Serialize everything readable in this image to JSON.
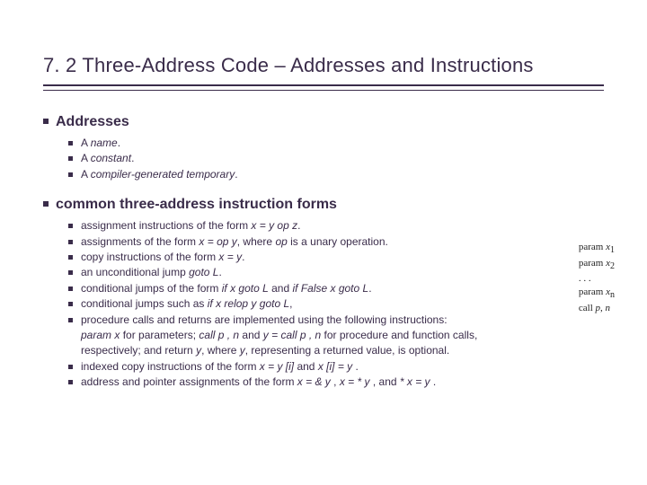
{
  "title": "7. 2 Three-Address Code – Addresses and Instructions",
  "section1": {
    "heading": "Addresses",
    "items": {
      "a": {
        "pre": "A ",
        "em": "name",
        "post": "."
      },
      "b": {
        "pre": "A ",
        "em": "constant",
        "post": "."
      },
      "c": {
        "pre": "A ",
        "em": "compiler-generated temporary",
        "post": "."
      }
    }
  },
  "section2": {
    "heading": "common three-address instruction forms",
    "items": {
      "a": {
        "pre": "assignment instructions of the form ",
        "em": "x = y op z",
        "post": "."
      },
      "b": {
        "pre": "assignments of the form ",
        "em": "x = op y",
        "mid": ", where ",
        "em2": "op",
        "post": " is a unary operation."
      },
      "c": {
        "pre": "copy instructions of the form ",
        "em": "x = y",
        "post": "."
      },
      "d": {
        "pre": "an unconditional jump ",
        "em": "goto L",
        "post": "."
      },
      "e": {
        "pre": "conditional jumps of the form ",
        "em": "if x goto L",
        "mid": " and ",
        "em2": "if False x goto L",
        "post": "."
      },
      "f": {
        "pre": "conditional jumps such as ",
        "em": "if x relop y goto L",
        "post": ","
      },
      "g": {
        "line1": "procedure calls and returns are implemented using the following instructions:",
        "line2a": "param x",
        "line2b": " for parameters; ",
        "line2c": "call p , n",
        "line2d": " and ",
        "line2e": "y = call p , n",
        "line2f": " for procedure and function calls,",
        "line3a": "respectively; and return ",
        "line3b": "y",
        "line3c": ", where ",
        "line3d": "y",
        "line3e": ", representing a returned value, is optional."
      },
      "h": {
        "pre": "indexed copy instructions of the form ",
        "em": "x = y [i]",
        "mid": " and ",
        "em2": "x [i] = y",
        "post": " ."
      },
      "i": {
        "pre": "address and pointer assignments of the form ",
        "em": "x = & y",
        "mid": " , ",
        "em2": "x = * y",
        "mid2": " , and ",
        "em3": "* x = y",
        "post": " ."
      }
    }
  },
  "codebox": {
    "l1a": "param ",
    "l1b": "x",
    "l1c": "1",
    "l2a": "param ",
    "l2b": "x",
    "l2c": "2",
    "l3": ". . .",
    "l4a": "param ",
    "l4b": "x",
    "l4c": "n",
    "l5a": "call ",
    "l5b": "p",
    "l5c": ", ",
    "l5d": "n"
  }
}
